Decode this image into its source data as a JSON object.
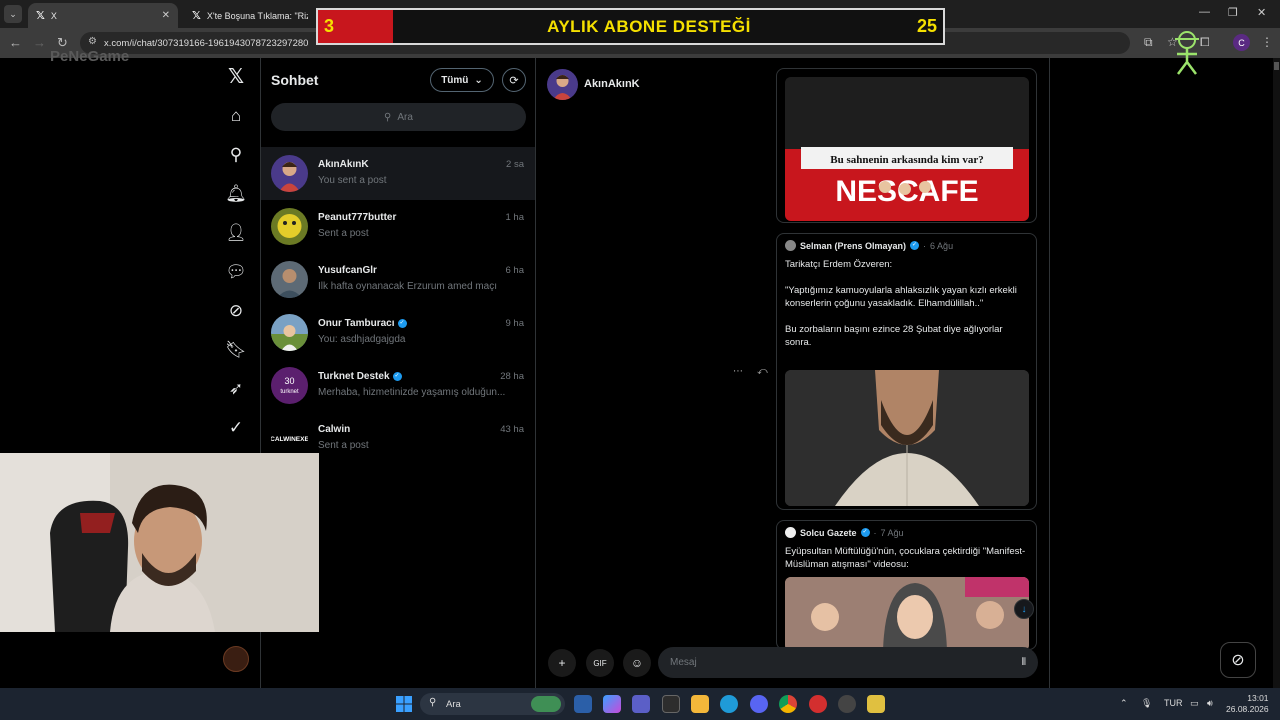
{
  "browser": {
    "tabs": [
      {
        "title": "X",
        "active": true
      },
      {
        "title": "X'te Boşuna Tıklama: \"Rize'de",
        "active": false
      }
    ],
    "url": "x.com/i/chat/307319166-1961943078723297280"
  },
  "overlay": {
    "banner_left": "3",
    "banner_title": "AYLIK ABONE DESTEĞİ",
    "banner_right": "25",
    "banner_progress": 0.12,
    "watermark": "PeNeGame"
  },
  "sidebar": {
    "title": "Sohbet",
    "filter_label": "Tümü",
    "search_placeholder": "Ara",
    "conversations": [
      {
        "name": "AkınAkınK",
        "snippet": "You sent a post",
        "time": "2 sa",
        "verified": false,
        "active": true
      },
      {
        "name": "Peanut777butter",
        "snippet": "Sent a post",
        "time": "1 ha",
        "verified": false,
        "active": false
      },
      {
        "name": "YusufcanGlr",
        "snippet": "İlk hafta oynanacak Erzurum amed maçı",
        "time": "6 ha",
        "verified": false,
        "active": false
      },
      {
        "name": "Onur Tamburacı",
        "snippet": "You: asdhjadgajgda",
        "time": "9 ha",
        "verified": true,
        "active": false
      },
      {
        "name": "Turknet Destek",
        "snippet": "Merhaba, hizmetinizde yaşamış olduğun...",
        "time": "28 ha",
        "verified": true,
        "active": false
      },
      {
        "name": "Calwin",
        "snippet": "Sent a post",
        "time": "43 ha",
        "verified": false,
        "active": false
      }
    ]
  },
  "chat": {
    "contact_name": "AkınAkınK",
    "cards": [
      {
        "media_caption": "Bu sahnenin arkasında kim var?",
        "media_brand": "NESCAFE"
      },
      {
        "author": "Selman (Prens Olmayan)",
        "date": "6 Ağu",
        "body": "Tarikatçı Erdem Özveren:\n\n\"Yaptığımız kamuoyularla ahlaksızlık yayan kızlı erkekli konserlerin çoğunu yasakladık. Elhamdülillah..\"\n\nBu zorbaların başını ezince 28 Şubat diye ağlıyorlar sonra."
      },
      {
        "author": "Solcu Gazete",
        "date": "7 Ağu",
        "body": "Eyüpsultan Müftülüğü'nün, çocuklara çektirdiği \"Manifest-Müslüman atışması\" videosu:"
      }
    ],
    "composer_placeholder": "Mesaj"
  },
  "taskbar": {
    "search_label": "Ara",
    "language": "TUR",
    "time": "13:01",
    "date": "26.08.2026"
  },
  "colors": {
    "accent": "#1d9bf0",
    "banner_red": "#c8161d",
    "banner_yellow": "#f5e000",
    "taskbar": "#1c2430"
  }
}
